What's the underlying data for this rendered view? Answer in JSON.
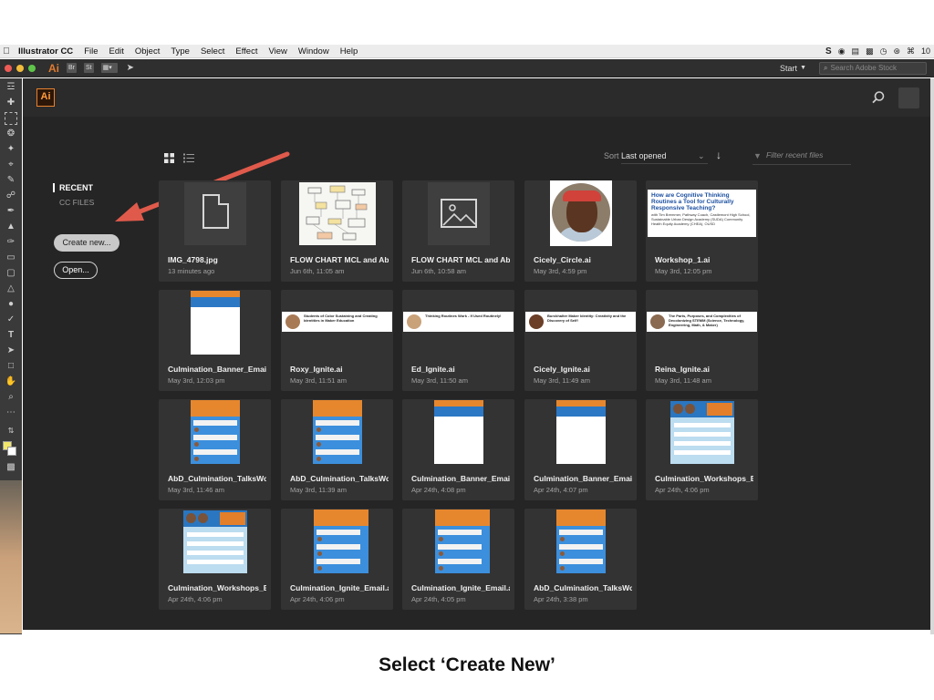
{
  "menubar": {
    "items": [
      "Illustrator CC",
      "File",
      "Edit",
      "Object",
      "Type",
      "Select",
      "Effect",
      "View",
      "Window",
      "Help"
    ],
    "clock": "10"
  },
  "appbar": {
    "ai_label": "Ai",
    "bridge_label": "Br",
    "stock_label": "St",
    "workspace_label": "Start",
    "stock_placeholder": "Search Adobe Stock"
  },
  "start_screen": {
    "logo": "Ai",
    "nav": {
      "recent": "RECENT",
      "cc_files": "CC FILES"
    },
    "buttons": {
      "create_new": "Create new...",
      "open": "Open..."
    },
    "sort": {
      "label": "Sort",
      "value": "Last opened",
      "direction": "descending"
    },
    "filter_placeholder": "Filter recent files",
    "files": [
      {
        "name": "IMG_4798.jpg",
        "date": "13 minutes ago",
        "thumb": "generic-file"
      },
      {
        "name": "FLOW CHART MCL and AbD_Culmination.ai",
        "date": "Jun 6th, 11:05 am",
        "thumb": "flowchart"
      },
      {
        "name": "FLOW CHART MCL and AbD_Culmination.jpg",
        "date": "Jun 6th, 10:58 am",
        "thumb": "generic-image"
      },
      {
        "name": "Cicely_Circle.ai",
        "date": "May 3rd, 4:59 pm",
        "thumb": "portrait-circle"
      },
      {
        "name": "Workshop_1.ai",
        "date": "May 3rd, 12:05 pm",
        "thumb": "workshop-banner"
      },
      {
        "name": "Culmination_Banner_Email.ai",
        "date": "May 3rd, 12:03 pm",
        "thumb": "tall-white"
      },
      {
        "name": "Roxy_Ignite.ai",
        "date": "May 3rd, 11:51 am",
        "thumb": "strip"
      },
      {
        "name": "Ed_Ignite.ai",
        "date": "May 3rd, 11:50 am",
        "thumb": "strip"
      },
      {
        "name": "Cicely_Ignite.ai",
        "date": "May 3rd, 11:49 am",
        "thumb": "strip"
      },
      {
        "name": "Reina_Ignite.ai",
        "date": "May 3rd, 11:48 am",
        "thumb": "strip"
      },
      {
        "name": "AbD_Culmination_TalksWorkshops.ai",
        "date": "May 3rd, 11:46 am",
        "thumb": "tall-blue"
      },
      {
        "name": "AbD_Culmination_TalksWorkshops.ai",
        "date": "May 3rd, 11:39 am",
        "thumb": "tall-blue"
      },
      {
        "name": "Culmination_Banner_Email.ai",
        "date": "Apr 24th, 4:08 pm",
        "thumb": "tall-white"
      },
      {
        "name": "Culmination_Banner_Email.ai",
        "date": "Apr 24th, 4:07 pm",
        "thumb": "tall-white"
      },
      {
        "name": "Culmination_Workshops_Email.ai",
        "date": "Apr 24th, 4:06 pm",
        "thumb": "wide-flyer"
      },
      {
        "name": "Culmination_Workshops_Email.ai",
        "date": "Apr 24th, 4:06 pm",
        "thumb": "wide-flyer"
      },
      {
        "name": "Culmination_Ignite_Email.ai",
        "date": "Apr 24th, 4:06 pm",
        "thumb": "tall-blue"
      },
      {
        "name": "Culmination_Ignite_Email.ai",
        "date": "Apr 24th, 4:05 pm",
        "thumb": "tall-blue"
      },
      {
        "name": "AbD_Culmination_TalksWorkshops.ai",
        "date": "Apr 24th, 3:38 pm",
        "thumb": "tall-blue"
      }
    ],
    "workshop_banner": {
      "title": "How are Cognitive Thinking Routines a Tool for Culturally Responsive Teaching?",
      "sub": "with Tim Bremmer, Pathway Coach, Castlemont High School, Sustainable Urban Design Academy (SUDA) Community Health Equity Academy (CHEA), OUSD"
    },
    "strips": [
      "Students of Color Sustaining and Creating Identities in Maker Education",
      "Thinking Routines Work - If Used Routinely!",
      "Burckhalter Maker Identity: Creativity and the Discovery of Self!",
      "The Parts, Purposes, and Complexities of Decolonizing STEMM (Science, Technology, Engineering, Math, & Maker)"
    ]
  },
  "caption": "Select ‘Create New’",
  "colors": {
    "window_bg": "#252525",
    "card_bg": "#333333",
    "ai_orange": "#e8822f",
    "arrow": "#e05a4b",
    "flyer_blue": "#3c8fdc",
    "flyer_orange": "#e6872e"
  }
}
